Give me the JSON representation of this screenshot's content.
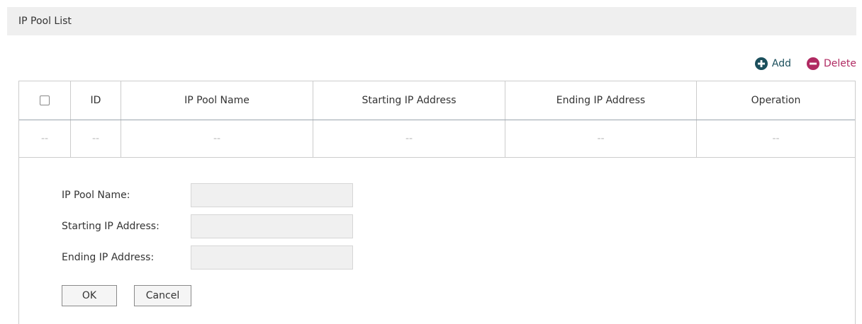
{
  "section": {
    "title": "IP Pool List"
  },
  "toolbar": {
    "add_label": "Add",
    "delete_label": "Delete",
    "add_color": "#1b4f5c",
    "delete_color": "#b02a62",
    "add_icon": "plus-circle-icon",
    "delete_icon": "minus-circle-icon"
  },
  "table": {
    "columns": [
      "ID",
      "IP Pool Name",
      "Starting IP Address",
      "Ending IP Address",
      "Operation"
    ],
    "rows": [
      [
        "--",
        "--",
        "--",
        "--",
        "--",
        "--"
      ]
    ]
  },
  "form": {
    "name_label": "IP Pool Name:",
    "start_label": "Starting IP Address:",
    "end_label": "Ending IP Address:",
    "name_value": "",
    "start_value": "",
    "end_value": "",
    "ok_label": "OK",
    "cancel_label": "Cancel"
  }
}
